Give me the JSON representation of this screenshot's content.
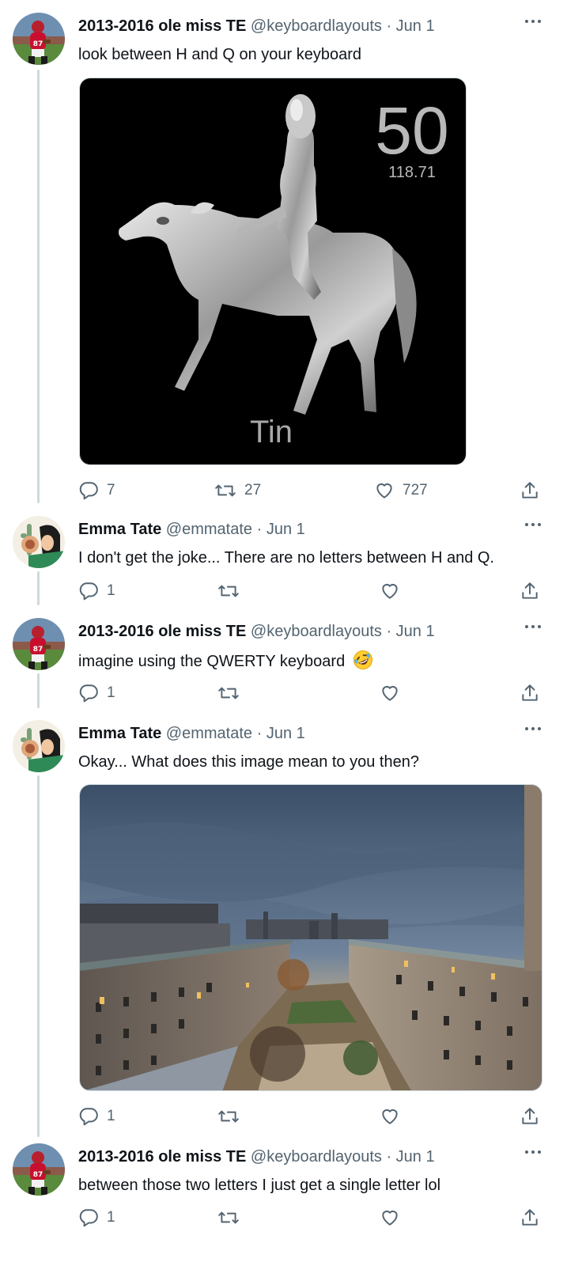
{
  "tweets": [
    {
      "name": "2013-2016 ole miss TE",
      "handle": "@keyboardlayouts",
      "date": "Jun 1",
      "text": "look between H and Q on your keyboard",
      "media": {
        "number": "50",
        "weight": "118.71",
        "element": "Tin"
      },
      "replies": "7",
      "retweets": "27",
      "likes": "727"
    },
    {
      "name": "Emma Tate",
      "handle": "@emmatate",
      "date": "Jun 1",
      "text": "I don't get the joke... There are no letters between H and Q.",
      "replies": "1",
      "retweets": "",
      "likes": ""
    },
    {
      "name": "2013-2016 ole miss TE",
      "handle": "@keyboardlayouts",
      "date": "Jun 1",
      "text": "imagine using the QWERTY keyboard",
      "emoji": "rolling-on-floor-laughing-emoji",
      "replies": "1",
      "retweets": "",
      "likes": ""
    },
    {
      "name": "Emma Tate",
      "handle": "@emmatate",
      "date": "Jun 1",
      "text": "Okay... What does this image mean to you then?",
      "replies": "1",
      "retweets": "",
      "likes": ""
    },
    {
      "name": "2013-2016 ole miss TE",
      "handle": "@keyboardlayouts",
      "date": "Jun 1",
      "text": "between those two letters I just get a single letter lol",
      "replies": "1",
      "retweets": "",
      "likes": ""
    }
  ],
  "separator": "·",
  "icons": {
    "more": "more-icon",
    "reply": "reply-icon",
    "retweet": "retweet-icon",
    "like": "like-icon",
    "share": "share-icon"
  },
  "colors": {
    "text": "#0f1419",
    "secondary": "#536471",
    "thread_line": "#cfd9de"
  }
}
